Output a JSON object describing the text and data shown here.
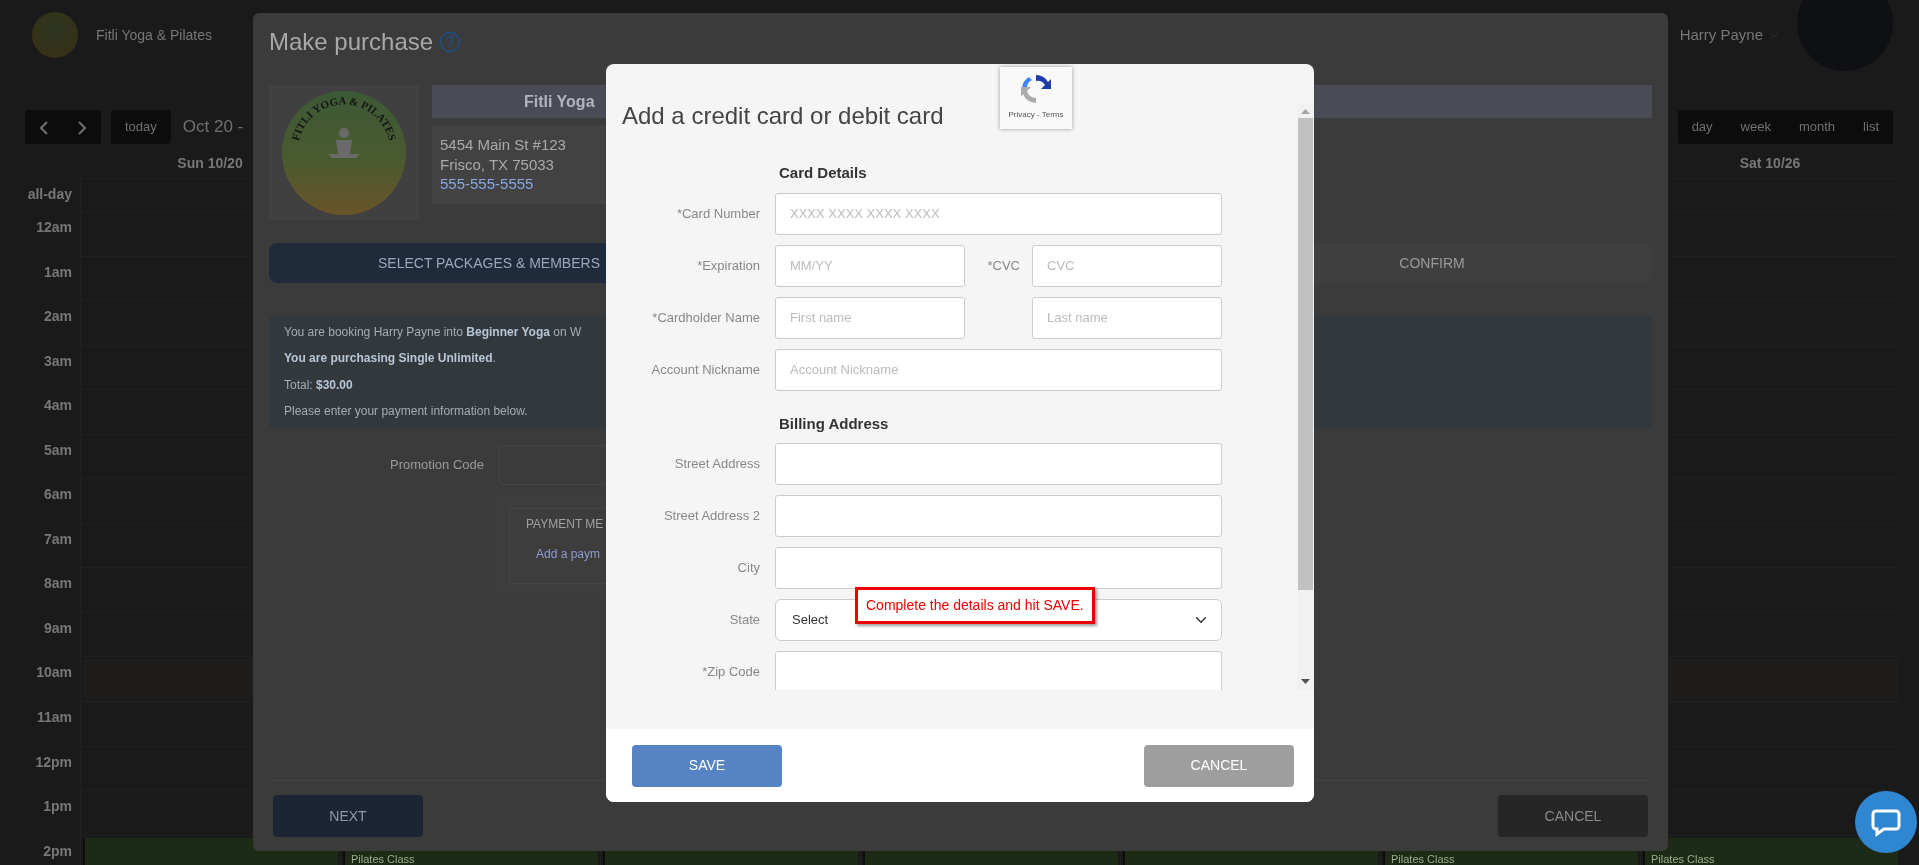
{
  "header": {
    "studio_name": "Fitli Yoga & Pilates",
    "user_name": "Harry Payne"
  },
  "calendar": {
    "today_button": "today",
    "date_range": "Oct 20 -",
    "views": [
      "day",
      "week",
      "month",
      "list"
    ],
    "day_headers": [
      {
        "label": "Sun 10/20"
      },
      {
        "label": "Sat 10/26"
      }
    ],
    "all_day_label": "all-day",
    "time_rows": [
      {
        "label": "12am"
      },
      {
        "label": "1am"
      },
      {
        "label": "2am"
      },
      {
        "label": "3am"
      },
      {
        "label": "4am"
      },
      {
        "label": "5am"
      },
      {
        "label": "6am"
      },
      {
        "label": "7am"
      },
      {
        "label": "8am"
      },
      {
        "label": "9am"
      },
      {
        "label": "10am",
        "events": [
          {
            "kind": "block"
          },
          {
            "kind": "block"
          },
          {
            "kind": "block"
          },
          {
            "kind": "block"
          },
          {
            "kind": "block"
          },
          {
            "kind": "block"
          },
          {
            "kind": "block"
          }
        ]
      },
      {
        "label": "11am"
      },
      {
        "label": "12pm"
      },
      {
        "label": "1pm"
      },
      {
        "label": "2pm",
        "events": [
          {
            "kind": "class"
          },
          {
            "kind": "class",
            "title": "Pilates Class"
          },
          {
            "kind": "class"
          },
          {
            "kind": "class"
          },
          {
            "kind": "class"
          },
          {
            "kind": "class",
            "title": "Pilates Class"
          },
          {
            "kind": "class",
            "title": "Pilates Class"
          }
        ]
      }
    ]
  },
  "purchase_dialog": {
    "title": "Make purchase",
    "studio": {
      "logo_text": "FITLI YOGA & PILATES",
      "name": "Fitli Yoga",
      "address_line_1": "5454 Main St #123",
      "address_line_2": "Frisco, TX 75033",
      "phone": "555-555-5555"
    },
    "steps": [
      {
        "label": "SELECT PACKAGES & MEMBERS",
        "selected": true
      },
      {
        "label": "CONFIRM",
        "selected": false
      }
    ],
    "summary": [
      "You are booking Harry Payne into **Beginner Yoga** on W",
      "**You are purchasing Single Unlimited**.",
      "Total: **$30.00**",
      "Please enter your payment information below."
    ],
    "promotion_code": {
      "label": "Promotion Code"
    },
    "payment_methods": {
      "title": "PAYMENT ME",
      "link": "Add a paym"
    },
    "buttons": [
      {
        "label": "NEXT",
        "kind": "primary"
      },
      {
        "label": "CANCEL",
        "kind": "secondary"
      }
    ]
  },
  "card_modal": {
    "title": "Add a credit card or debit card",
    "recaptcha_text": "Privacy - Terms",
    "sections": [
      {
        "heading": "Card Details",
        "rows": [
          {
            "label": "*Card Number",
            "fields": [
              {
                "kind": "text",
                "placeholder": "XXXX XXXX XXXX XXXX"
              }
            ]
          },
          {
            "label": "*Expiration",
            "fields": [
              {
                "kind": "text",
                "placeholder": "MM/YY"
              },
              {
                "kind": "text",
                "label": "*CVC",
                "placeholder": "CVC"
              }
            ]
          },
          {
            "label": "*Cardholder Name",
            "fields": [
              {
                "kind": "text",
                "placeholder": "First name"
              },
              {
                "kind": "text",
                "placeholder": "Last name"
              }
            ]
          },
          {
            "label": "Account Nickname",
            "fields": [
              {
                "kind": "text",
                "placeholder": "Account Nickname"
              }
            ]
          }
        ]
      },
      {
        "heading": "Billing Address",
        "rows": [
          {
            "label": "Street Address",
            "fields": [
              {
                "kind": "text"
              }
            ]
          },
          {
            "label": "Street Address 2",
            "fields": [
              {
                "kind": "text"
              }
            ]
          },
          {
            "label": "City",
            "fields": [
              {
                "kind": "text"
              }
            ]
          },
          {
            "label": "State",
            "fields": [
              {
                "kind": "select",
                "value": "Select"
              }
            ]
          },
          {
            "label": "*Zip Code",
            "fields": [
              {
                "kind": "text"
              }
            ]
          }
        ]
      }
    ],
    "callout": "Complete the details and hit SAVE.",
    "buttons": [
      {
        "label": "SAVE",
        "kind": "primary"
      },
      {
        "label": "CANCEL",
        "kind": "secondary"
      }
    ]
  }
}
